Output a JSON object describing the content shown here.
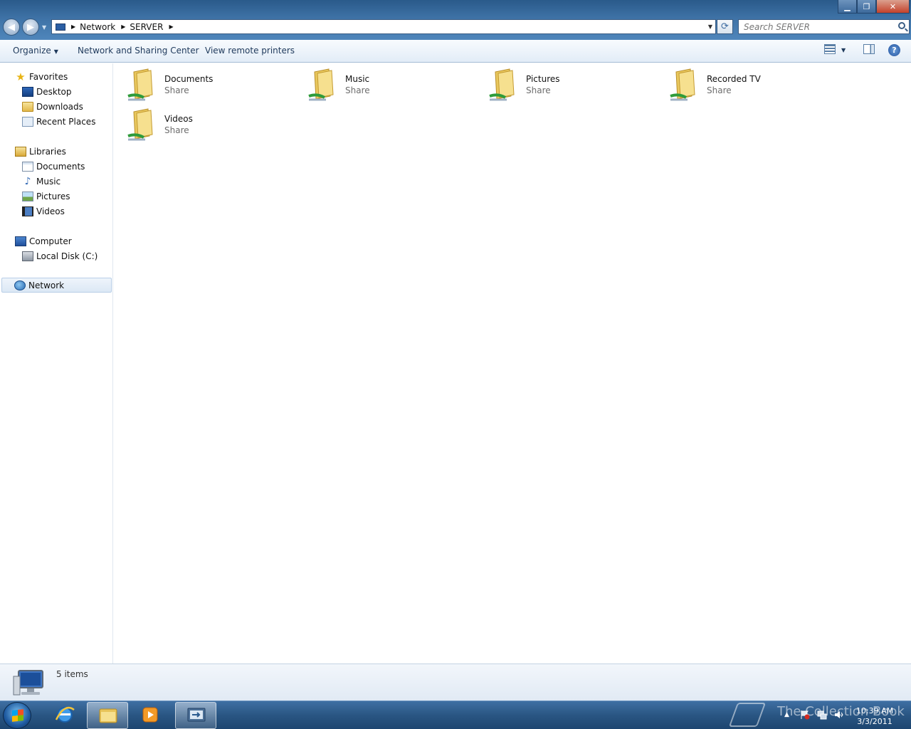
{
  "window": {
    "controls": {
      "minimize": "▁",
      "maximize": "❐",
      "close": "✕"
    }
  },
  "address": {
    "crumbs": [
      "Network",
      "SERVER"
    ],
    "search_placeholder": "Search SERVER"
  },
  "toolbar": {
    "organize_label": "Organize",
    "network_center_label": "Network and Sharing Center",
    "remote_printers_label": "View remote printers"
  },
  "nav": {
    "favorites": {
      "label": "Favorites",
      "items": [
        "Desktop",
        "Downloads",
        "Recent Places"
      ]
    },
    "libraries": {
      "label": "Libraries",
      "items": [
        "Documents",
        "Music",
        "Pictures",
        "Videos"
      ]
    },
    "computer": {
      "label": "Computer",
      "items": [
        "Local Disk (C:)"
      ]
    },
    "network": {
      "label": "Network"
    }
  },
  "shares": [
    {
      "name": "Documents",
      "type": "Share"
    },
    {
      "name": "Music",
      "type": "Share"
    },
    {
      "name": "Pictures",
      "type": "Share"
    },
    {
      "name": "Recorded TV",
      "type": "Share"
    },
    {
      "name": "Videos",
      "type": "Share"
    }
  ],
  "details": {
    "item_count": "5 items"
  },
  "taskbar": {
    "clock_time": "10:39 AM",
    "clock_date": "3/3/2011",
    "watermark": "The Collection Book"
  },
  "colors": {
    "accent": "#2a5a8a",
    "taskbar": "#2a5683",
    "folder": "#e8c45a"
  }
}
